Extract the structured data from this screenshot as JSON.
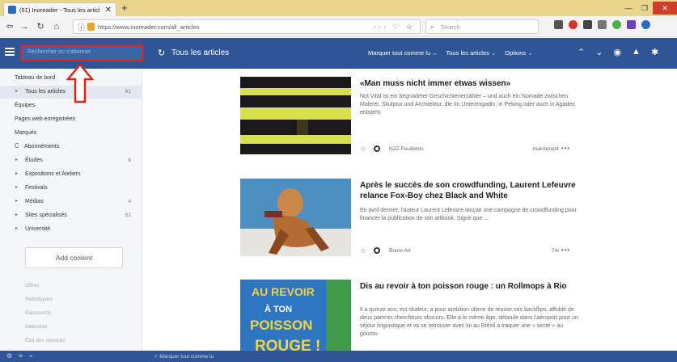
{
  "browser": {
    "tab_title": "(61) Inoreader - Tous les articl",
    "url": "https://www.inoreader.com/all_articles",
    "url_domain": "inoreader.com",
    "url_actions": "··· ♡ ☆",
    "search_placeholder": "Search"
  },
  "app": {
    "search_placeholder": "Rechercher ou s'abonner",
    "title": "Tous les articles",
    "actions": {
      "mark_read": "Marquer tout comme lu",
      "view_filter": "Tous les articles",
      "options": "Options"
    }
  },
  "sidebar": {
    "items": [
      {
        "label": "Tableau de bord",
        "count": ""
      },
      {
        "label": "Tous les articles",
        "count": "61"
      },
      {
        "label": "Équipes",
        "count": ""
      },
      {
        "label": "Pages web enregistrées",
        "count": ""
      },
      {
        "label": "Marqués",
        "count": ""
      },
      {
        "label": "Abonnements",
        "count": ""
      },
      {
        "label": "Études",
        "count": "6"
      },
      {
        "label": "Expositions et Ateliers",
        "count": ""
      },
      {
        "label": "Festivals",
        "count": ""
      },
      {
        "label": "Médias",
        "count": "4"
      },
      {
        "label": "Sites spécialisés",
        "count": "51"
      },
      {
        "label": "Université",
        "count": ""
      }
    ],
    "add_content": "Add content",
    "footer": [
      "Offres",
      "Statistiques",
      "Raccourcis",
      "Détection",
      "État des services"
    ]
  },
  "articles": [
    {
      "title": "«Man muss nicht immer etwas wissen»",
      "snippet": "Not Vital ist ein begnadeter Geschichtenerzähler – und auch ein Nomade zwischen Malerei, Skulptur und Architektur, die im Unterengadin, in Peking oder auch in Agadez entsteht.",
      "source": "NZZ Feuilleton",
      "time": "maintenant",
      "thumb_colors": [
        "#1a1a1a",
        "#d8e04a"
      ]
    },
    {
      "title": "Après le succès de son crowdfunding, Laurent Lefeuvre relance Fox-Boy chez Black and White",
      "snippet": "En avril dernier, l'auteur Laurent Lefeuvre lançait une campagne de crowdfunding pour financer la publication de son artbook. Signe que ...",
      "source": "Bome Art",
      "time": "7m",
      "thumb_colors": [
        "#4d8fc1",
        "#c7884a"
      ]
    },
    {
      "title": "Dis au revoir à ton poisson rouge : un Rollmops à Rio",
      "snippet": "Il a quinze ans, est skateur, a pour ambition ultime de réussir ses backflips, affublé de deux parents chercheurs obscurs. Elle a le même âge, déboule dans l'aéroport pour un séjour linguistique et va se retrouver avec lui au Brésil à traquer une « secte » au gourou",
      "source": "",
      "time": "",
      "thumb_colors": [
        "#2f76c2",
        "#f0d341"
      ],
      "thumb_text": [
        "AU REVOIR",
        "À TON",
        "POISSON",
        "ROUGE !"
      ]
    }
  ],
  "bottom": {
    "mark_read": "Marquer tout comme lu"
  }
}
